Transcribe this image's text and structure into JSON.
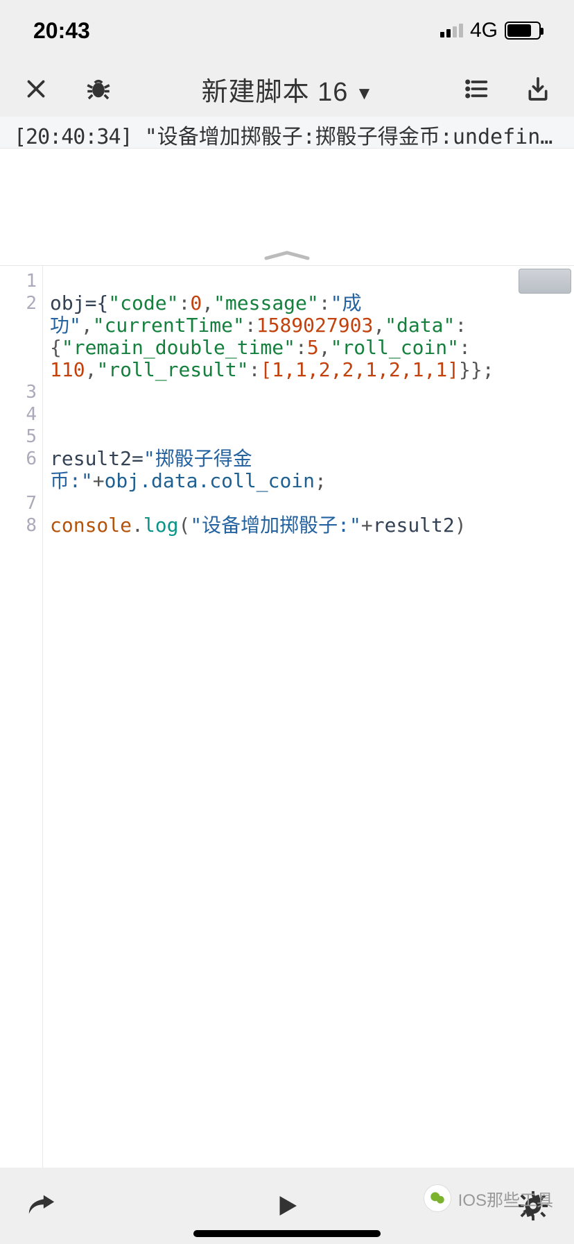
{
  "statusBar": {
    "time": "20:43",
    "network": "4G"
  },
  "toolbar": {
    "title": "新建脚本 16"
  },
  "log": {
    "timestamp": "[20:40:34]",
    "message": "\"设备增加掷骰子:掷骰子得金币:undefin…"
  },
  "code": {
    "lines": {
      "1": "",
      "2_segments": {
        "pre": "obj={",
        "k1": "\"code\"",
        "v1": "0",
        "k2": "\"message\"",
        "v2_a": "\"成",
        "v2_b": "功\"",
        "k3": "\"currentTime\"",
        "v3": "1589027903",
        "k4": "\"data\"",
        "k5": "\"remain_double_time\"",
        "v5": "5",
        "k6": "\"roll_coin\"",
        "v6": "110",
        "k7": "\"roll_result\"",
        "arr": "[1,1,2,2,1,2,1,1]",
        "post": "}};"
      },
      "6_segments": {
        "pre": "result2=",
        "str_a": "\"掷骰子得金",
        "str_b": "币:\"",
        "plus": "+",
        "expr": "obj.data.coll_coin",
        "end": ";"
      },
      "8_segments": {
        "indent": " ",
        "obj": "console",
        "dot": ".",
        "fn": "log",
        "p1": "(",
        "str": "\"设备增加掷骰子:\"",
        "plus": "+",
        "arg": "result2",
        "p2": ")"
      }
    },
    "lineNumbers": [
      "1",
      "2",
      "3",
      "4",
      "5",
      "6",
      "7",
      "8"
    ]
  },
  "watermark": {
    "text": "IOS那些工具"
  }
}
